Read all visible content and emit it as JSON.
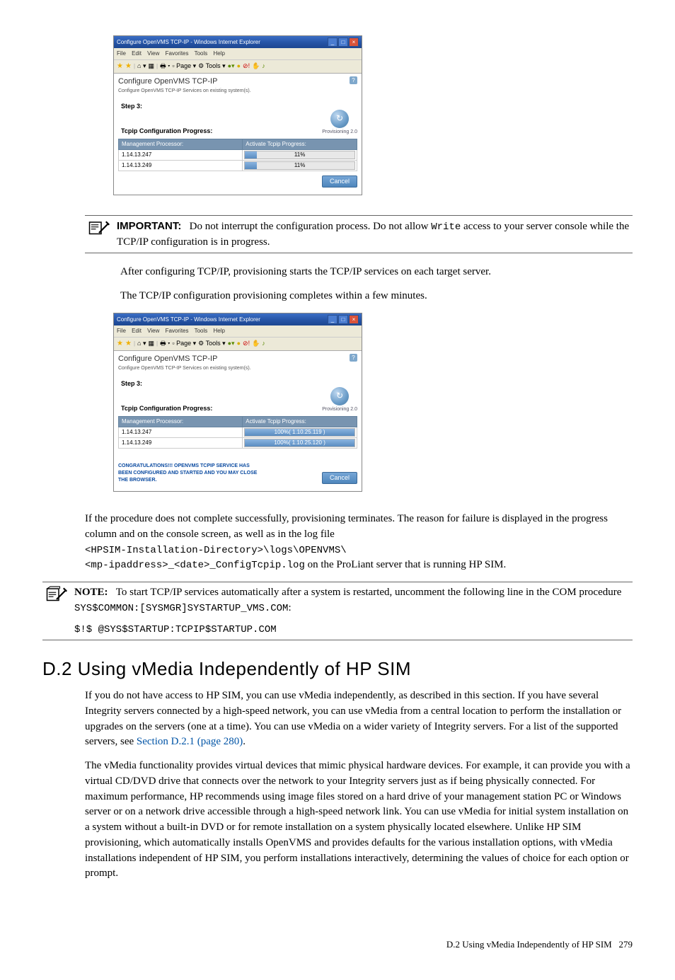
{
  "screenshot1": {
    "titlebar": "Configure OpenVMS TCP-IP - Windows Internet Explorer",
    "menu": {
      "file": "File",
      "edit": "Edit",
      "view": "View",
      "favorites": "Favorites",
      "tools": "Tools",
      "help": "Help"
    },
    "toolbar": {
      "page": "Page",
      "tools": "Tools"
    },
    "cfg_title": "Configure OpenVMS TCP-IP",
    "cfg_sub": "Configure OpenVMS TCP-IP Services on existing system(s).",
    "step": "Step 3:",
    "prov_caption": "Provisioning 2.0",
    "prog_caption": "Tcpip Configuration Progress:",
    "th1": "Management Processor:",
    "th2": "Activate Tcpip Progress:",
    "rows": [
      {
        "ip": "1.14.13.247",
        "pct": 11,
        "label": "11%"
      },
      {
        "ip": "1.14.13.249",
        "pct": 11,
        "label": "11%"
      }
    ],
    "cancel": "Cancel"
  },
  "important": {
    "label": "IMPORTANT:",
    "text_a": "Do not interrupt the configuration process. Do not allow ",
    "code": "Write",
    "text_b": " access to your server console while the TCP/IP configuration is in progress."
  },
  "para_after_cfg": "After configuring TCP/IP, provisioning starts the TCP/IP services on each target server.",
  "para_completes": "The TCP/IP configuration provisioning completes within a few minutes.",
  "screenshot2": {
    "titlebar": "Configure OpenVMS TCP-IP - Windows Internet Explorer",
    "menu": {
      "file": "File",
      "edit": "Edit",
      "view": "View",
      "favorites": "Favorites",
      "tools": "Tools",
      "help": "Help"
    },
    "toolbar": {
      "page": "Page",
      "tools": "Tools"
    },
    "cfg_title": "Configure OpenVMS TCP-IP",
    "cfg_sub": "Configure OpenVMS TCP-IP Services on existing system(s).",
    "step": "Step 3:",
    "prov_caption": "Provisioning 2.0",
    "prog_caption": "Tcpip Configuration Progress:",
    "th1": "Management Processor:",
    "th2": "Activate Tcpip Progress:",
    "rows": [
      {
        "ip": "1.14.13.247",
        "pct": 100,
        "label": "100%( 1.10.25.119 )"
      },
      {
        "ip": "1.14.13.249",
        "pct": 100,
        "label": "100%( 1.10.25.120 )"
      }
    ],
    "congrats": "CONGRATULATIONS!!! OPENVMS TCPIP SERVICE HAS BEEN CONFIGURED AND STARTED AND YOU MAY CLOSE THE BROWSER.",
    "cancel": "Cancel"
  },
  "failure": {
    "p1": "If the procedure does not complete successfully, provisioning terminates. The reason for failure is displayed in the progress column and on the console screen, as well as in the log file ",
    "code1": "<HPSIM-Installation-Directory>\\logs\\OPENVMS\\",
    "code2": "<mp-ipaddress>_<date>_ConfigTcpip.log",
    "p2": " on the ProLiant server that is running HP SIM."
  },
  "note": {
    "label": "NOTE:",
    "text_a": "To start TCP/IP services automatically after a system is restarted, uncomment the following line in the COM procedure ",
    "code1": "SYS$COMMON:[SYSMGR]SYSTARTUP_VMS.COM",
    "colon": ":",
    "code2": "$!$ @SYS$STARTUP:TCPIP$STARTUP.COM"
  },
  "section": {
    "heading": "D.2 Using vMedia Independently of HP SIM",
    "p1a": "If you do not have access to HP SIM, you can use vMedia independently, as described in this section. If you have several Integrity servers connected by a high-speed network, you can use vMedia from a central location to perform the installation or upgrades on the servers (one at a time). You can use vMedia on a wider variety of Integrity servers. For a list of the supported servers, see ",
    "link": "Section D.2.1 (page 280)",
    "p1b": ".",
    "p2": "The vMedia functionality provides virtual devices that mimic physical hardware devices. For example, it can provide you with a virtual CD/DVD drive that connects over the network to your Integrity servers just as if being physically connected. For maximum performance, HP recommends using image files stored on a hard drive of your management station PC or Windows server or on a network drive accessible through a high-speed network link. You can use vMedia for initial system installation on a system without a built-in DVD or for remote installation on a system physically located elsewhere. Unlike HP SIM provisioning, which automatically installs OpenVMS and provides defaults for the various installation options, with vMedia installations independent of HP SIM, you perform installations interactively, determining the values of choice for each option or prompt."
  },
  "footer": {
    "text": "D.2 Using vMedia Independently of HP SIM",
    "page": "279"
  }
}
